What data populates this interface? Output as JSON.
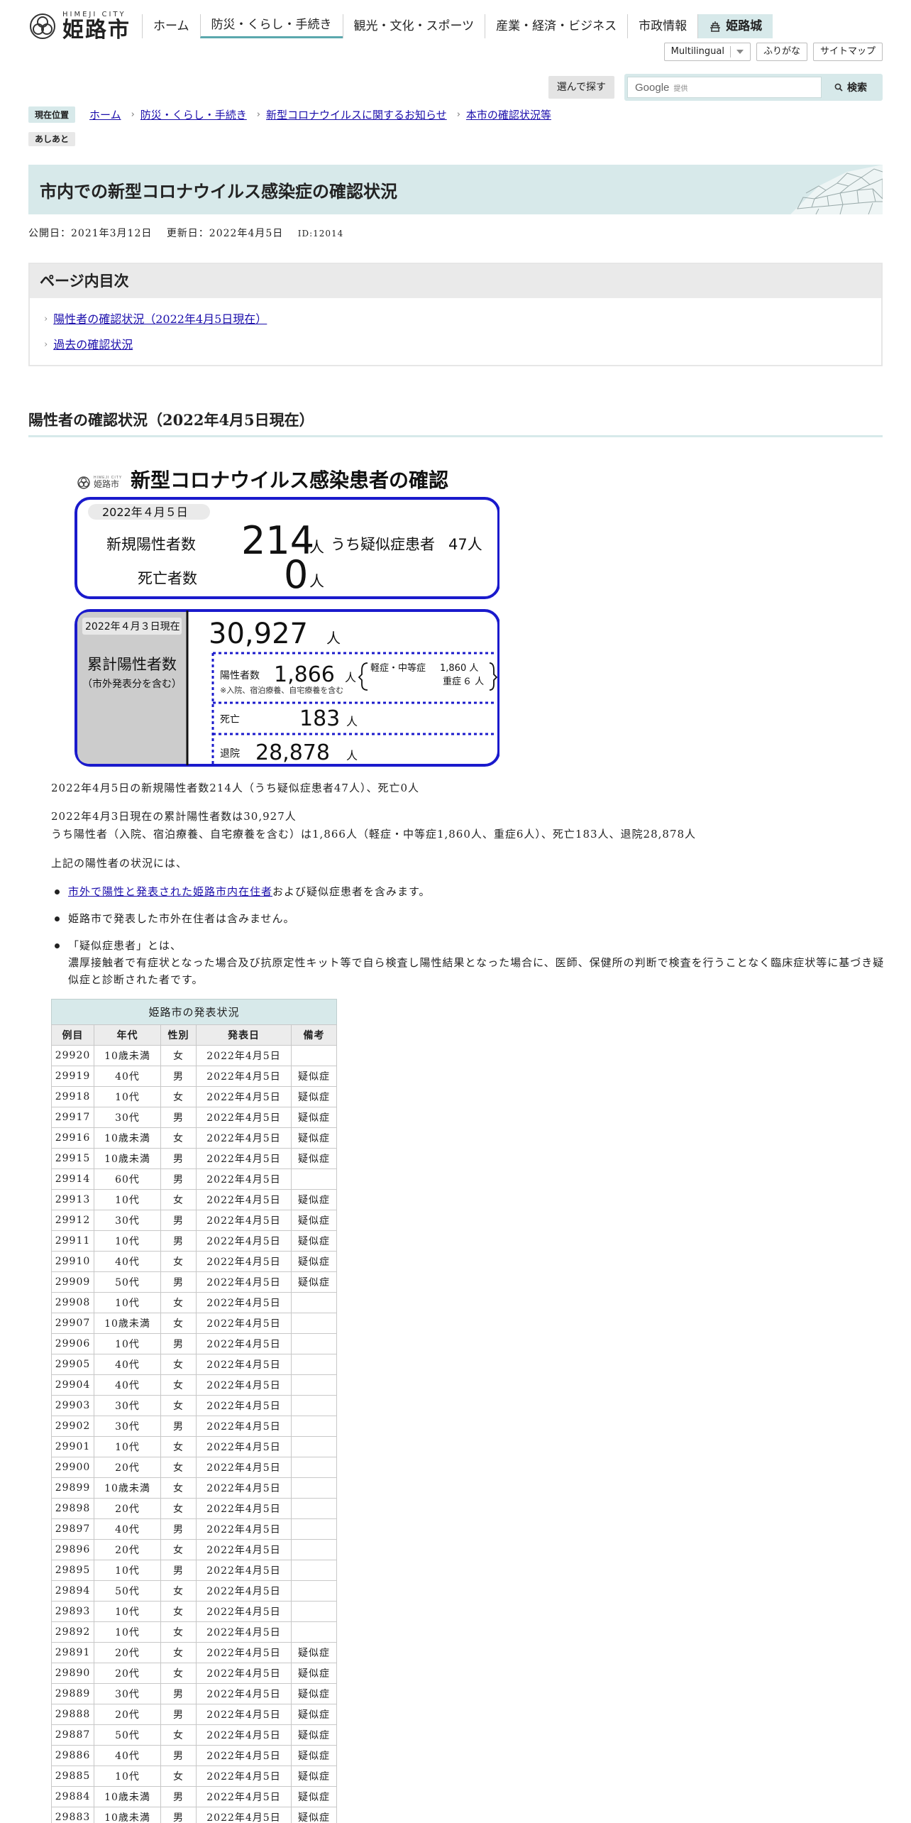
{
  "site": {
    "logo_en": "HIMEJI CITY",
    "logo_ja": "姫路市"
  },
  "gnav": [
    "ホーム",
    "防災・くらし・手続き",
    "観光・文化・スポーツ",
    "産業・経済・ビジネス",
    "市政情報",
    "姫路城"
  ],
  "subnav": {
    "multilingual": "Multilingual",
    "furigana": "ふりがな",
    "sitemap": "サイトマップ"
  },
  "search": {
    "pick_label": "選んで探す",
    "google": "Google",
    "provided": "提供",
    "button": "検索"
  },
  "breadcrumb": {
    "label": "現在位置",
    "items": [
      "ホーム",
      "防災・くらし・手続き",
      "新型コロナウイルスに関するお知らせ",
      "本市の確認状況等"
    ],
    "ashiato": "あしあと"
  },
  "page": {
    "title": "市内での新型コロナウイルス感染症の確認状況",
    "published": "公開日：2021年3月12日",
    "updated": "更新日：2022年4月5日",
    "id": "ID:12014"
  },
  "toc": {
    "heading": "ページ内目次",
    "items": [
      "陽性者の確認状況（2022年4月5日現在）",
      "過去の確認状況"
    ]
  },
  "section": {
    "heading": "陽性者の確認状況（2022年4月5日現在）"
  },
  "infographic": {
    "city": "姫路市",
    "city_en": "HIMEJI CITY",
    "title": "新型コロナウイルス感染患者の確認",
    "date": "2022年４月５日",
    "new_label": "新規陽性者数",
    "new_value": "214",
    "unit": "人",
    "suspected_label": "うち疑似症患者",
    "suspected_value": "47人",
    "death_label": "死亡者数",
    "death_value": "0",
    "cum_date": "2022年４月３日現在",
    "cum_label": "累計陽性者数",
    "cum_note": "（市外発表分を含む）",
    "cum_value": "30,927",
    "pos_label": "陽性者数",
    "pos_value": "1,866",
    "pos_note": "※入院、宿泊療養、自宅療養を含む",
    "mild_label": "軽症・中等症",
    "mild_value": "1,860 人",
    "severe_label": "重症",
    "severe_value": "６ 人",
    "died_label": "死亡",
    "died_value": "183",
    "discharged_label": "退院",
    "discharged_value": "28,878"
  },
  "paragraphs": {
    "p1": "2022年4月5日の新規陽性者数214人（うち疑似症患者47人）、死亡0人",
    "p2a": "2022年4月3日現在の累計陽性者数は30,927人",
    "p2b": "うち陽性者（入院、宿泊療養、自宅療養を含む）は1,866人（軽症・中等症1,860人、重症6人）、死亡183人、退院28,878人",
    "p3": "上記の陽性者の状況には、"
  },
  "bullets": {
    "b1_link": "市外で陽性と発表された姫路市内在住者",
    "b1_rest": "および疑似症患者を含みます。",
    "b2": "姫路市で発表した市外在住者は含みません。",
    "b3_head": "「疑似症患者」とは、",
    "b3_body": "濃厚接触者で有症状となった場合及び抗原定性キット等で自ら検査し陽性結果となった場合に、医師、保健所の判断で検査を行うことなく臨床症状等に基づき疑似症と診断された者です。"
  },
  "table": {
    "caption": "姫路市の発表状況",
    "headers": [
      "例目",
      "年代",
      "性別",
      "発表日",
      "備考"
    ],
    "rows": [
      [
        "29920",
        "10歳未満",
        "女",
        "2022年4月5日",
        ""
      ],
      [
        "29919",
        "40代",
        "男",
        "2022年4月5日",
        "疑似症"
      ],
      [
        "29918",
        "10代",
        "女",
        "2022年4月5日",
        "疑似症"
      ],
      [
        "29917",
        "30代",
        "男",
        "2022年4月5日",
        "疑似症"
      ],
      [
        "29916",
        "10歳未満",
        "女",
        "2022年4月5日",
        "疑似症"
      ],
      [
        "29915",
        "10歳未満",
        "男",
        "2022年4月5日",
        "疑似症"
      ],
      [
        "29914",
        "60代",
        "男",
        "2022年4月5日",
        ""
      ],
      [
        "29913",
        "10代",
        "女",
        "2022年4月5日",
        "疑似症"
      ],
      [
        "29912",
        "30代",
        "男",
        "2022年4月5日",
        "疑似症"
      ],
      [
        "29911",
        "10代",
        "男",
        "2022年4月5日",
        "疑似症"
      ],
      [
        "29910",
        "40代",
        "女",
        "2022年4月5日",
        "疑似症"
      ],
      [
        "29909",
        "50代",
        "男",
        "2022年4月5日",
        "疑似症"
      ],
      [
        "29908",
        "10代",
        "女",
        "2022年4月5日",
        ""
      ],
      [
        "29907",
        "10歳未満",
        "女",
        "2022年4月5日",
        ""
      ],
      [
        "29906",
        "10代",
        "男",
        "2022年4月5日",
        ""
      ],
      [
        "29905",
        "40代",
        "女",
        "2022年4月5日",
        ""
      ],
      [
        "29904",
        "40代",
        "女",
        "2022年4月5日",
        ""
      ],
      [
        "29903",
        "30代",
        "女",
        "2022年4月5日",
        ""
      ],
      [
        "29902",
        "30代",
        "男",
        "2022年4月5日",
        ""
      ],
      [
        "29901",
        "10代",
        "女",
        "2022年4月5日",
        ""
      ],
      [
        "29900",
        "20代",
        "女",
        "2022年4月5日",
        ""
      ],
      [
        "29899",
        "10歳未満",
        "女",
        "2022年4月5日",
        ""
      ],
      [
        "29898",
        "20代",
        "女",
        "2022年4月5日",
        ""
      ],
      [
        "29897",
        "40代",
        "男",
        "2022年4月5日",
        ""
      ],
      [
        "29896",
        "20代",
        "女",
        "2022年4月5日",
        ""
      ],
      [
        "29895",
        "10代",
        "男",
        "2022年4月5日",
        ""
      ],
      [
        "29894",
        "50代",
        "女",
        "2022年4月5日",
        ""
      ],
      [
        "29893",
        "10代",
        "女",
        "2022年4月5日",
        ""
      ],
      [
        "29892",
        "10代",
        "女",
        "2022年4月5日",
        ""
      ],
      [
        "29891",
        "20代",
        "女",
        "2022年4月5日",
        "疑似症"
      ],
      [
        "29890",
        "20代",
        "女",
        "2022年4月5日",
        "疑似症"
      ],
      [
        "29889",
        "30代",
        "男",
        "2022年4月5日",
        "疑似症"
      ],
      [
        "29888",
        "20代",
        "男",
        "2022年4月5日",
        "疑似症"
      ],
      [
        "29887",
        "50代",
        "女",
        "2022年4月5日",
        "疑似症"
      ],
      [
        "29886",
        "40代",
        "男",
        "2022年4月5日",
        "疑似症"
      ],
      [
        "29885",
        "10代",
        "女",
        "2022年4月5日",
        "疑似症"
      ],
      [
        "29884",
        "10歳未満",
        "男",
        "2022年4月5日",
        "疑似症"
      ],
      [
        "29883",
        "10歳未満",
        "男",
        "2022年4月5日",
        "疑似症"
      ]
    ]
  },
  "colors": {
    "accent": "#d7e9ea",
    "infographic_border": "#1a1acc",
    "link": "#1a0dab"
  }
}
